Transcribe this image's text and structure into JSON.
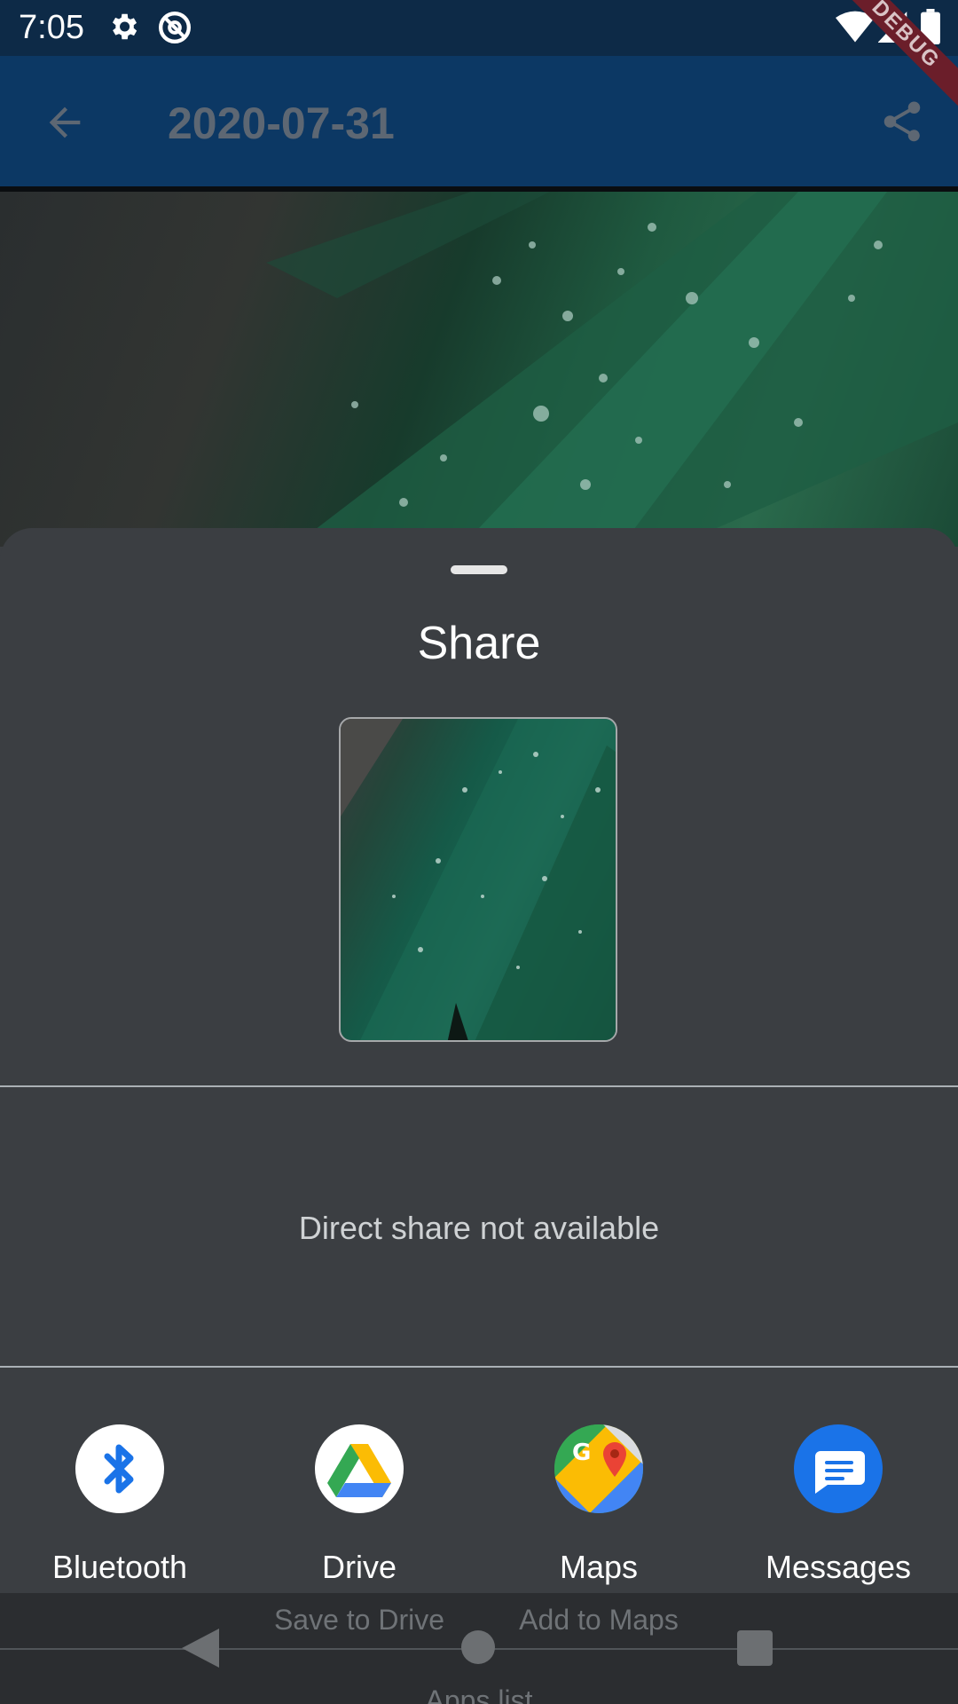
{
  "status_bar": {
    "time": "7:05",
    "icons": [
      "gear-icon",
      "do-not-disturb-icon",
      "wifi-icon",
      "signal-icon",
      "battery-icon"
    ]
  },
  "debug_banner": {
    "label": "DEBUG"
  },
  "app_bar": {
    "title": "2020-07-31",
    "back_icon": "arrow-back-icon",
    "share_icon": "share-icon",
    "colors": {
      "background": "#0c3864",
      "title": "#5d6773"
    }
  },
  "share_sheet": {
    "title": "Share",
    "direct_share_text": "Direct share not available",
    "apps": [
      {
        "label": "Bluetooth",
        "icon": "bluetooth-icon",
        "sub_label": ""
      },
      {
        "label": "Drive",
        "icon": "google-drive-icon",
        "sub_label": "Save to Drive"
      },
      {
        "label": "Maps",
        "icon": "google-maps-icon",
        "sub_label": "Add to Maps"
      },
      {
        "label": "Messages",
        "icon": "messages-icon",
        "sub_label": ""
      }
    ],
    "apps_list_label": "Apps list",
    "colors": {
      "background": "#3b3e42",
      "bluetooth": "#1a73e8",
      "messages": "#1a73e8"
    }
  },
  "nav_bar": {
    "icons": [
      "nav-back-icon",
      "nav-home-icon",
      "nav-recents-icon"
    ]
  }
}
